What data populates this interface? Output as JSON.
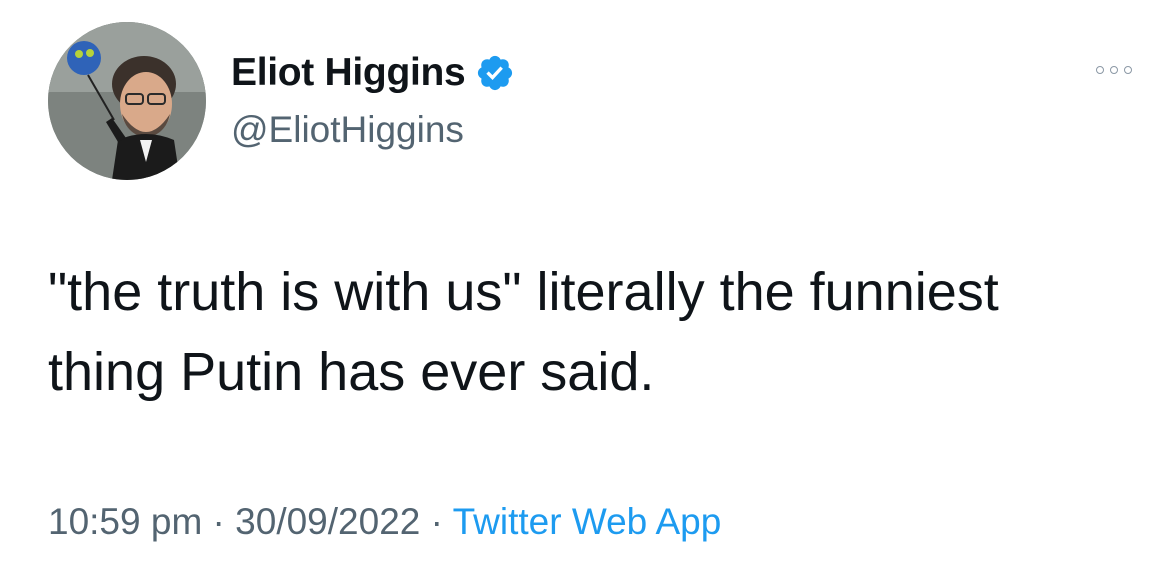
{
  "author": {
    "display_name": "Eliot Higgins",
    "handle": "@EliotHiggins",
    "verified": true,
    "avatar_icon": "profile-photo-cartoon"
  },
  "tweet": {
    "text": "\"the truth is with us\" literally the funniest thing Putin has ever said."
  },
  "meta": {
    "time": "10:59 pm",
    "separator": " · ",
    "date": "30/09/2022",
    "source": "Twitter Web App"
  },
  "icons": {
    "more": "more-dots-icon",
    "verified": "verified-badge-icon"
  },
  "colors": {
    "accent": "#1d9bf0",
    "secondary_text": "#536471",
    "primary_text": "#0f1419"
  }
}
